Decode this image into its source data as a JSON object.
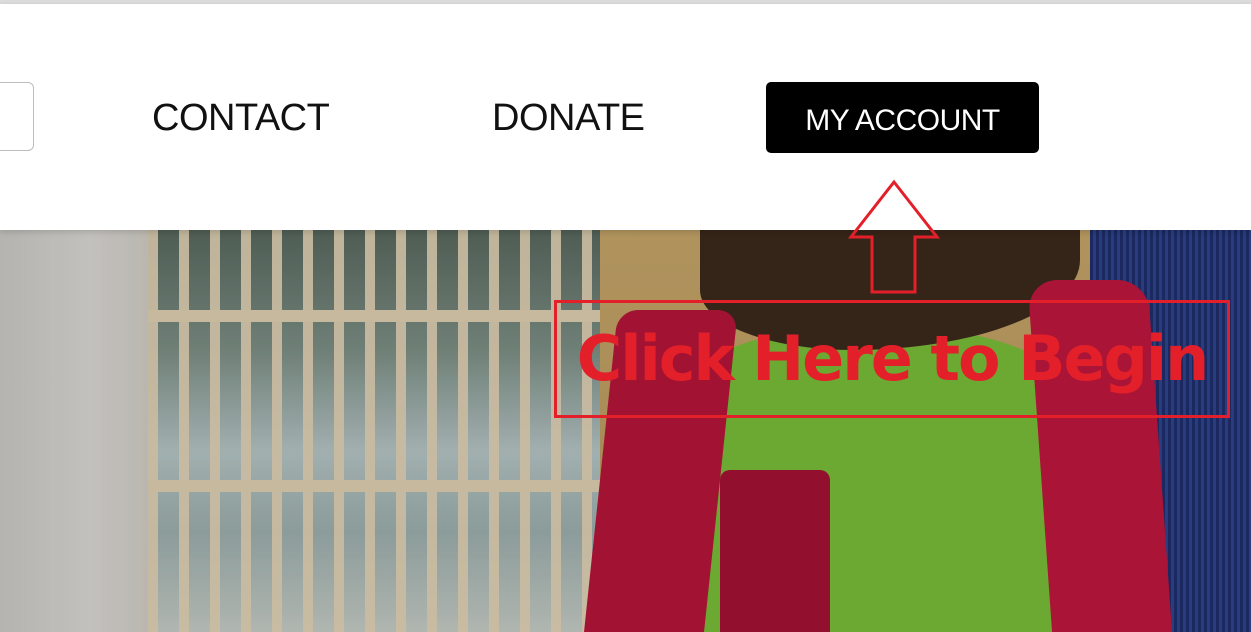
{
  "nav": {
    "contact_label": "CONTACT",
    "donate_label": "DONATE",
    "account_label": "MY ACCOUNT"
  },
  "annotation": {
    "callout_text": "Click Here to Begin",
    "arrow_icon": "up-arrow-outline-icon",
    "color": "#e3202a"
  },
  "colors": {
    "account_button_bg": "#000000",
    "account_button_text": "#ffffff",
    "nav_text": "#111111"
  }
}
